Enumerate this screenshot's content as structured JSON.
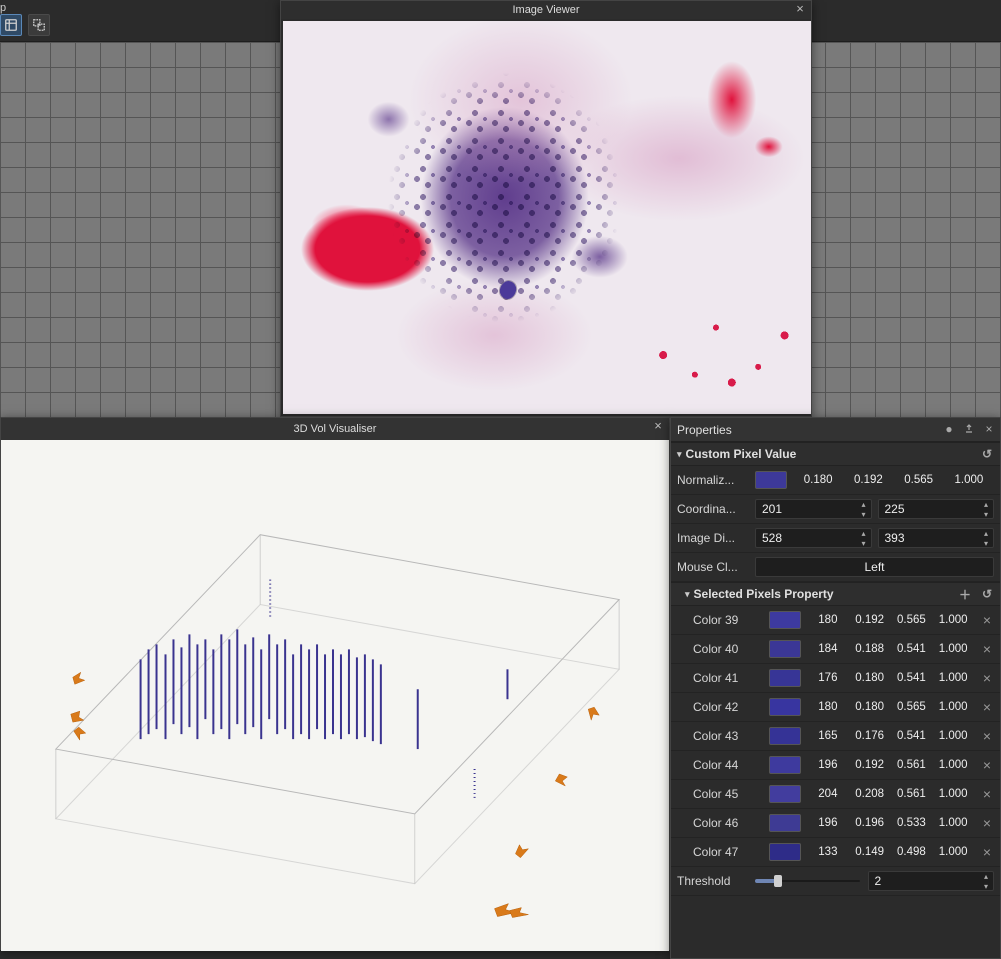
{
  "toolbar": {
    "menu_partial": "p"
  },
  "image_viewer": {
    "title": "Image Viewer"
  },
  "vol_vis": {
    "title": "3D Vol Visualiser"
  },
  "properties": {
    "title": "Properties",
    "sections": {
      "custom_pixel": {
        "title": "Custom Pixel Value",
        "normalized_label": "Normaliz...",
        "normalized_values": [
          "0.180",
          "0.192",
          "0.565",
          "1.000"
        ],
        "normalized_swatch": "#3d399a",
        "coord_label": "Coordina...",
        "coord_x": "201",
        "coord_y": "225",
        "dim_label": "Image Di...",
        "dim_w": "528",
        "dim_h": "393",
        "mouse_label": "Mouse Cl...",
        "mouse_value": "Left"
      },
      "selected_pixels": {
        "title": "Selected Pixels Property",
        "rows": [
          {
            "label": "Color 39",
            "vals": [
              "180",
              "0.192",
              "0.565",
              "1.000"
            ],
            "swatch": "#3d3aa0"
          },
          {
            "label": "Color 40",
            "vals": [
              "184",
              "0.188",
              "0.541",
              "1.000"
            ],
            "swatch": "#3b3796"
          },
          {
            "label": "Color 41",
            "vals": [
              "176",
              "0.180",
              "0.541",
              "1.000"
            ],
            "swatch": "#373596"
          },
          {
            "label": "Color 42",
            "vals": [
              "180",
              "0.180",
              "0.565",
              "1.000"
            ],
            "swatch": "#3835a0"
          },
          {
            "label": "Color 43",
            "vals": [
              "165",
              "0.176",
              "0.541",
              "1.000"
            ],
            "swatch": "#353396"
          },
          {
            "label": "Color 44",
            "vals": [
              "196",
              "0.192",
              "0.561",
              "1.000"
            ],
            "swatch": "#3e3a9e"
          },
          {
            "label": "Color 45",
            "vals": [
              "204",
              "0.208",
              "0.561",
              "1.000"
            ],
            "swatch": "#423d9e"
          },
          {
            "label": "Color 46",
            "vals": [
              "196",
              "0.196",
              "0.533",
              "1.000"
            ],
            "swatch": "#3e3b94"
          },
          {
            "label": "Color 47",
            "vals": [
              "133",
              "0.149",
              "0.498",
              "1.000"
            ],
            "swatch": "#2e2c88"
          }
        ],
        "threshold_label": "Threshold",
        "threshold_value": "2",
        "threshold_fill_pct": 22
      }
    }
  }
}
